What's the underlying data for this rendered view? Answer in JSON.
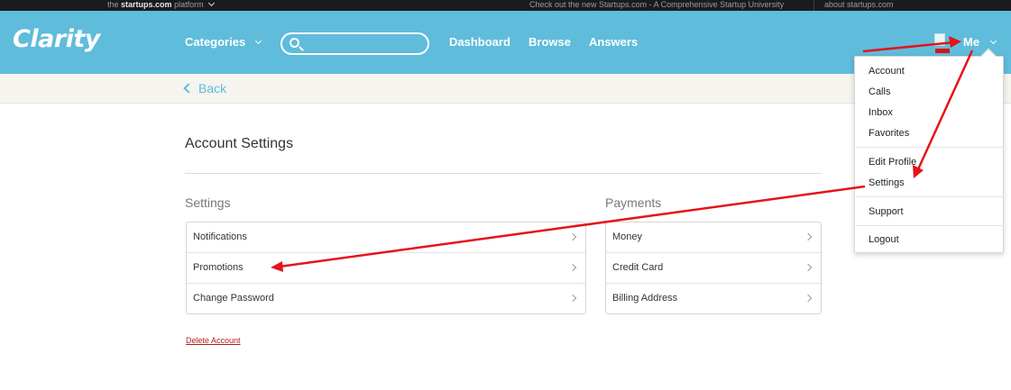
{
  "topbar": {
    "platform_prefix": "the",
    "platform_brand": "startups.com",
    "platform_suffix": "platform",
    "promo": "Check out the new Startups.com - A Comprehensive Startup University",
    "about": "about startups.com"
  },
  "nav": {
    "logo": "Clarity",
    "categories": "Categories",
    "search_value": "",
    "links": [
      "Dashboard",
      "Browse",
      "Answers"
    ],
    "me": "Me"
  },
  "back": "Back",
  "page": {
    "title": "Account Settings",
    "settings": {
      "title": "Settings",
      "items": [
        "Notifications",
        "Promotions",
        "Change Password"
      ]
    },
    "payments": {
      "title": "Payments",
      "items": [
        "Money",
        "Credit Card",
        "Billing Address"
      ]
    },
    "delete": "Delete Account"
  },
  "menu": {
    "items": [
      "Account",
      "Calls",
      "Inbox",
      "Favorites",
      "Edit Profile",
      "Settings",
      "Support",
      "Logout"
    ]
  },
  "colors": {
    "brand": "#5fbcdb",
    "annotation": "#e3141a",
    "delete": "#b31b1b"
  }
}
